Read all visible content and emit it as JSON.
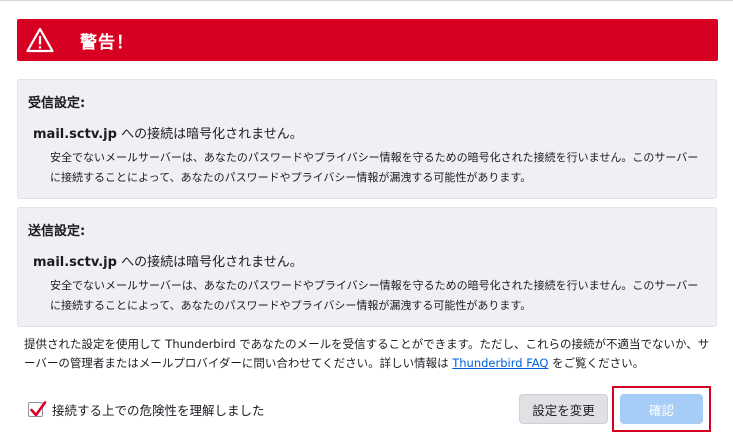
{
  "warning": {
    "title": "警告！"
  },
  "incoming": {
    "heading": "受信設定:",
    "host": "mail.sctv.jp",
    "host_suffix": " への接続は暗号化されません。",
    "description": "安全でないメールサーバーは、あなたのパスワードやプライバシー情報を守るための暗号化された接続を行いません。このサーバーに接続することによって、あなたのパスワードやプライバシー情報が漏洩する可能性があります。"
  },
  "outgoing": {
    "heading": "送信設定:",
    "host": "mail.sctv.jp",
    "host_suffix": " への接続は暗号化されません。",
    "description": "安全でないメールサーバーは、あなたのパスワードやプライバシー情報を守るための暗号化された接続を行いません。このサーバーに接続することによって、あなたのパスワードやプライバシー情報が漏洩する可能性があります。"
  },
  "info": {
    "text_before": "提供された設定を使用して Thunderbird であなたのメールを受信することができます。ただし、これらの接続が不適当でないか、サーバーの管理者またはメールプロバイダーに問い合わせてください。詳しい情報は ",
    "link": "Thunderbird FAQ",
    "text_after": " をご覧ください。"
  },
  "checkbox": {
    "label": "接続する上での危険性を理解しました",
    "checked": true
  },
  "buttons": {
    "change_settings": "設定を変更",
    "confirm": "確認"
  },
  "colors": {
    "accent": "#d70022",
    "confirm_disabled": "#a6cdf5",
    "link": "#0061e0"
  }
}
